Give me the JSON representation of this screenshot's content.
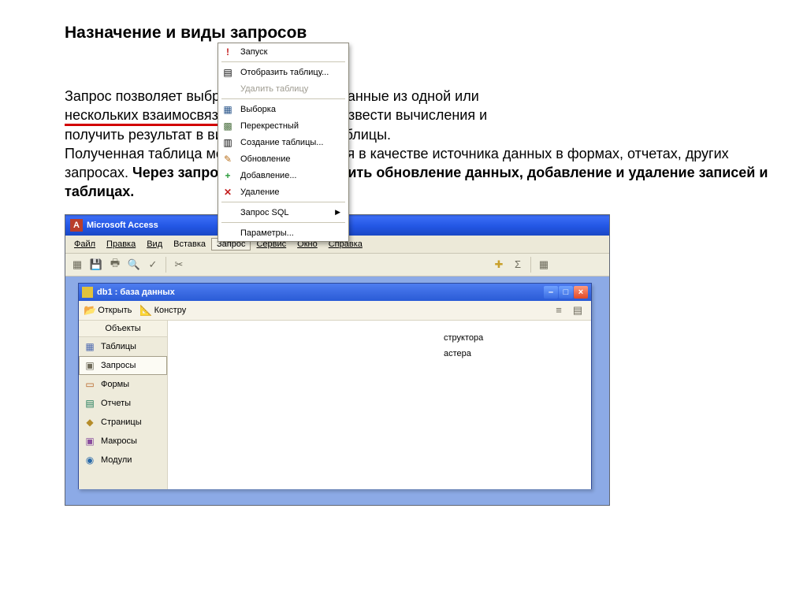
{
  "heading": "Назначение и виды запросов",
  "paragraph": {
    "seg1": "Запрос позволяет выбрать необходимые данные из одной или",
    "seg2_under": "нескольких взаимосвязанных таблиц,",
    "seg2_rest": " произвести вычисления и",
    "seg3": "получить результат в виде виртуальной таблицы.",
    "seg4": "Полученная таблица может использоваться в качестве источника данных в формах, отчетах, других запросах. ",
    "bold": "Через запрос можно производить обновление данных, добавление и удаление записей и таблицах."
  },
  "app": {
    "title": "Microsoft Access"
  },
  "menu": {
    "file": "Файл",
    "edit": "Правка",
    "view": "Вид",
    "insert": "Вставка",
    "query": "Запрос",
    "service": "Сервис",
    "window": "Окно",
    "help": "Справка"
  },
  "dropdown": {
    "run": "Запуск",
    "show_table": "Отобразить таблицу...",
    "del_table": "Удалить таблицу",
    "select": "Выборка",
    "crosstab": "Перекрестный",
    "make_table": "Создание таблицы...",
    "update": "Обновление",
    "append": "Добавление...",
    "delete": "Удаление",
    "sql": "Запрос SQL",
    "params": "Параметры..."
  },
  "dbwin": {
    "title": "db1 : база данных",
    "open": "Открыть",
    "design": "Констру",
    "objects": "Объекты",
    "tables": "Таблицы",
    "queries": "Запросы",
    "forms": "Формы",
    "reports": "Отчеты",
    "pages": "Страницы",
    "macros": "Макросы",
    "modules": "Модули",
    "line1": "структора",
    "line2": "астера"
  },
  "icons": {
    "run": "!",
    "show_table": "▤",
    "select": "▦",
    "crosstab": "▩",
    "make_table": "▥",
    "update": "✎",
    "append": "+",
    "delete": "✕"
  }
}
